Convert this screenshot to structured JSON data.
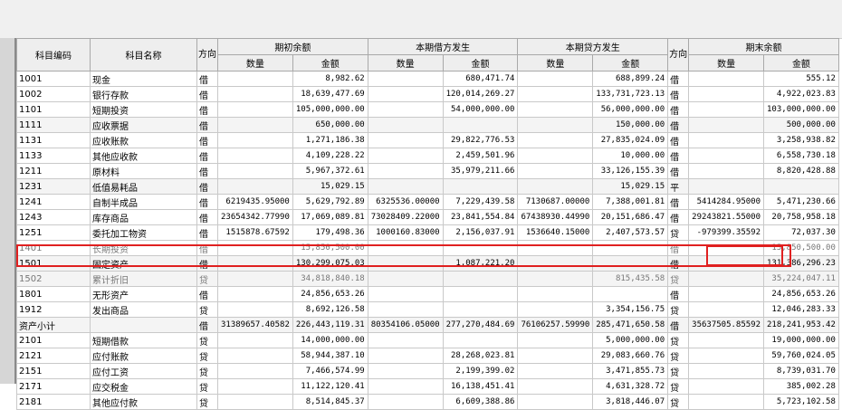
{
  "headers": {
    "code": "科目编码",
    "name": "科目名称",
    "direction": "方向",
    "opening": "期初余额",
    "debit": "本期借方发生",
    "credit": "本期贷方发生",
    "closing": "期末余额",
    "qty": "数量",
    "amount": "金额"
  },
  "rows": [
    {
      "code": "1001",
      "name": "现金",
      "dir": "借",
      "oq": "",
      "oa": "8,982.62",
      "dq": "",
      "da": "680,471.74",
      "cq": "",
      "ca": "688,899.24",
      "edir": "借",
      "eq": "",
      "ea": "555.12"
    },
    {
      "code": "1002",
      "name": "银行存款",
      "dir": "借",
      "oq": "",
      "oa": "18,639,477.69",
      "dq": "",
      "da": "120,014,269.27",
      "cq": "",
      "ca": "133,731,723.13",
      "edir": "借",
      "eq": "",
      "ea": "4,922,023.83"
    },
    {
      "code": "1101",
      "name": "短期投资",
      "dir": "借",
      "oq": "",
      "oa": "105,000,000.00",
      "dq": "",
      "da": "54,000,000.00",
      "cq": "",
      "ca": "56,000,000.00",
      "edir": "借",
      "eq": "",
      "ea": "103,000,000.00"
    },
    {
      "code": "1111",
      "name": "应收票据",
      "dir": "借",
      "oq": "",
      "oa": "650,000.00",
      "dq": "",
      "da": "",
      "cq": "",
      "ca": "150,000.00",
      "edir": "借",
      "eq": "",
      "ea": "500,000.00"
    },
    {
      "code": "1131",
      "name": "应收账款",
      "dir": "借",
      "oq": "",
      "oa": "1,271,186.38",
      "dq": "",
      "da": "29,822,776.53",
      "cq": "",
      "ca": "27,835,024.09",
      "edir": "借",
      "eq": "",
      "ea": "3,258,938.82"
    },
    {
      "code": "1133",
      "name": "其他应收款",
      "dir": "借",
      "oq": "",
      "oa": "4,109,228.22",
      "dq": "",
      "da": "2,459,501.96",
      "cq": "",
      "ca": "10,000.00",
      "edir": "借",
      "eq": "",
      "ea": "6,558,730.18"
    },
    {
      "code": "1211",
      "name": "原材料",
      "dir": "借",
      "oq": "",
      "oa": "5,967,372.61",
      "dq": "",
      "da": "35,979,211.66",
      "cq": "",
      "ca": "33,126,155.39",
      "edir": "借",
      "eq": "",
      "ea": "8,820,428.88"
    },
    {
      "code": "1231",
      "name": "低值易耗品",
      "dir": "借",
      "oq": "",
      "oa": "15,029.15",
      "dq": "",
      "da": "",
      "cq": "",
      "ca": "15,029.15",
      "edir": "平",
      "eq": "",
      "ea": ""
    },
    {
      "code": "1241",
      "name": "自制半成品",
      "dir": "借",
      "oq": "6219435.95000",
      "oa": "5,629,792.89",
      "dq": "6325536.00000",
      "da": "7,229,439.58",
      "cq": "7130687.00000",
      "ca": "7,388,001.81",
      "edir": "借",
      "eq": "5414284.95000",
      "ea": "5,471,230.66"
    },
    {
      "code": "1243",
      "name": "库存商品",
      "dir": "借",
      "oq": "23654342.77990",
      "oa": "17,069,089.81",
      "dq": "73028409.22000",
      "da": "23,841,554.84",
      "cq": "67438930.44990",
      "ca": "20,151,686.47",
      "edir": "借",
      "eq": "29243821.55000",
      "ea": "20,758,958.18"
    },
    {
      "code": "1251",
      "name": "委托加工物资",
      "dir": "借",
      "oq": "1515878.67592",
      "oa": "179,498.36",
      "dq": "1000160.83000",
      "da": "2,156,037.91",
      "cq": "1536640.15000",
      "ca": "2,407,573.57",
      "edir": "贷",
      "eq": "-979399.35592",
      "ea": "72,037.30"
    },
    {
      "code": "1401",
      "name": "长期投资",
      "dir": "借",
      "oq": "",
      "oa": "15,850,500.00",
      "dq": "",
      "da": "",
      "cq": "",
      "ca": "",
      "edir": "借",
      "eq": "",
      "ea": "15,850,500.00"
    },
    {
      "code": "1501",
      "name": "固定资产",
      "dir": "借",
      "oq": "",
      "oa": "130,299,075.03",
      "dq": "",
      "da": "1,087,221.20",
      "cq": "",
      "ca": "",
      "edir": "借",
      "eq": "",
      "ea": "131,386,296.23"
    },
    {
      "code": "1502",
      "name": "累计折旧",
      "dir": "贷",
      "oq": "",
      "oa": "34,818,840.18",
      "dq": "",
      "da": "",
      "cq": "",
      "ca": "815,435.58",
      "edir": "贷",
      "eq": "",
      "ea": "35,224,047.11"
    },
    {
      "code": "1801",
      "name": "无形资产",
      "dir": "借",
      "oq": "",
      "oa": "24,856,653.26",
      "dq": "",
      "da": "",
      "cq": "",
      "ca": "",
      "edir": "借",
      "eq": "",
      "ea": "24,856,653.26"
    },
    {
      "code": "1912",
      "name": "发出商品",
      "dir": "贷",
      "oq": "",
      "oa": "8,692,126.58",
      "dq": "",
      "da": "",
      "cq": "",
      "ca": "3,354,156.75",
      "edir": "贷",
      "eq": "",
      "ea": "12,046,283.33"
    },
    {
      "code": "资产小计",
      "name": "",
      "dir": "借",
      "oq": "31389657.40582",
      "oa": "226,443,119.31",
      "dq": "80354106.05000",
      "da": "277,270,484.69",
      "cq": "76106257.59990",
      "ca": "285,471,650.58",
      "edir": "借",
      "eq": "35637505.85592",
      "ea": "218,241,953.42"
    },
    {
      "code": "2101",
      "name": "短期借款",
      "dir": "贷",
      "oq": "",
      "oa": "14,000,000.00",
      "dq": "",
      "da": "",
      "cq": "",
      "ca": "5,000,000.00",
      "edir": "贷",
      "eq": "",
      "ea": "19,000,000.00"
    },
    {
      "code": "2121",
      "name": "应付账款",
      "dir": "贷",
      "oq": "",
      "oa": "58,944,387.10",
      "dq": "",
      "da": "28,268,023.81",
      "cq": "",
      "ca": "29,083,660.76",
      "edir": "贷",
      "eq": "",
      "ea": "59,760,024.05"
    },
    {
      "code": "2151",
      "name": "应付工资",
      "dir": "贷",
      "oq": "",
      "oa": "7,466,574.99",
      "dq": "",
      "da": "2,199,399.02",
      "cq": "",
      "ca": "3,471,855.73",
      "edir": "贷",
      "eq": "",
      "ea": "8,739,031.70"
    },
    {
      "code": "2171",
      "name": "应交税金",
      "dir": "贷",
      "oq": "",
      "oa": "11,122,120.41",
      "dq": "",
      "da": "16,138,451.41",
      "cq": "",
      "ca": "4,631,328.72",
      "edir": "贷",
      "eq": "",
      "ea": "385,002.28"
    },
    {
      "code": "2181",
      "name": "其他应付款",
      "dir": "贷",
      "oq": "",
      "oa": "8,514,845.37",
      "dq": "",
      "da": "6,609,388.86",
      "cq": "",
      "ca": "3,818,446.07",
      "edir": "贷",
      "eq": "",
      "ea": "5,723,102.58"
    }
  ],
  "highlight_color": "#e02020"
}
